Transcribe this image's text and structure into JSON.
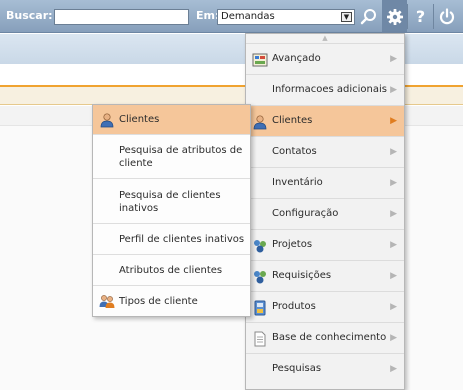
{
  "topbar": {
    "search_label": "Buscar:",
    "search_value": "",
    "em_label": "Em:",
    "em_selected": "Demandas",
    "icons": [
      "search-icon",
      "gear-icon",
      "help-icon",
      "power-icon"
    ]
  },
  "main_menu": {
    "items": [
      {
        "label": "Avançado",
        "icon": "advanced-icon",
        "arrow": "▶"
      },
      {
        "label": "Informacoes adicionais",
        "icon": "",
        "arrow": "▶"
      },
      {
        "label": "Clientes",
        "icon": "user-icon",
        "arrow": "▶"
      },
      {
        "label": "Contatos",
        "icon": "",
        "arrow": "▶"
      },
      {
        "label": "Inventário",
        "icon": "",
        "arrow": "▶"
      },
      {
        "label": "Configuração",
        "icon": "",
        "arrow": "▶"
      },
      {
        "label": "Projetos",
        "icon": "projects-icon",
        "arrow": "▶"
      },
      {
        "label": "Requisições",
        "icon": "requests-icon",
        "arrow": "▶"
      },
      {
        "label": "Produtos",
        "icon": "products-icon",
        "arrow": "▶"
      },
      {
        "label": "Base de conhecimento",
        "icon": "document-icon",
        "arrow": "▶"
      },
      {
        "label": "Pesquisas",
        "icon": "",
        "arrow": "▶"
      }
    ]
  },
  "sub_menu": {
    "items": [
      {
        "label": "Clientes",
        "icon": "user-icon"
      },
      {
        "label": "Pesquisa de atributos de cliente",
        "icon": ""
      },
      {
        "label": "Pesquisa de clientes inativos",
        "icon": ""
      },
      {
        "label": "Perfil de clientes inativos",
        "icon": ""
      },
      {
        "label": "Atributos de clientes",
        "icon": ""
      },
      {
        "label": "Tipos de cliente",
        "icon": "user-group-icon"
      }
    ]
  },
  "colors": {
    "topbar": "#8ea6c0",
    "highlight": "#f5c69a",
    "accent_line": "#f0a330"
  }
}
